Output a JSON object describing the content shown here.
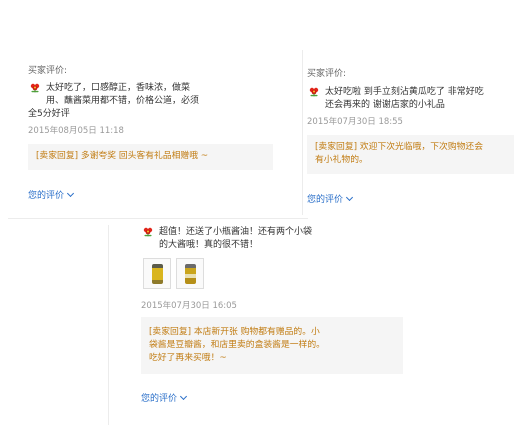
{
  "reviews": [
    {
      "label": "买家评价:",
      "lines": [
        "太好吃了，口感醇正，香味浓，做菜",
        "用、蘸酱菜用都不错，价格公道，必须",
        "全5分好评"
      ],
      "date": "2015年08月05日 11:18",
      "reply": [
        "[卖家回复] 多谢夸奖 回头客有礼品相赠哦 ~"
      ],
      "link": "您的评价"
    },
    {
      "label": "买家评价:",
      "lines": [
        "太好吃啦 到手立刻沾黄瓜吃了 非常好吃",
        "还会再来的 谢谢店家的小礼品"
      ],
      "date": "2015年07月30日 18:55",
      "reply": [
        "[卖家回复] 欢迎下次光临哦，下次购物还会",
        "有小礼物的。"
      ],
      "link": "您的评价"
    },
    {
      "lines": [
        "超值！还送了小瓶酱油！还有两个小袋",
        "的大酱哦！真的很不错！"
      ],
      "date": "2015年07月30日 16:05",
      "reply": [
        "[卖家回复] 本店新开张 购物都有赠品的。小",
        "袋酱是豆瓣酱，和店里卖的盒装酱是一样的。",
        "吃好了再来买哦！~"
      ],
      "link": "您的评价"
    }
  ],
  "colors": {
    "reply_text": "#c17c12",
    "link": "#2a6fc9",
    "date": "#9a9a9a"
  },
  "icons": {
    "rating": "red-flower-icon",
    "expand": "chevron-down-icon",
    "photo": "product-photo"
  }
}
